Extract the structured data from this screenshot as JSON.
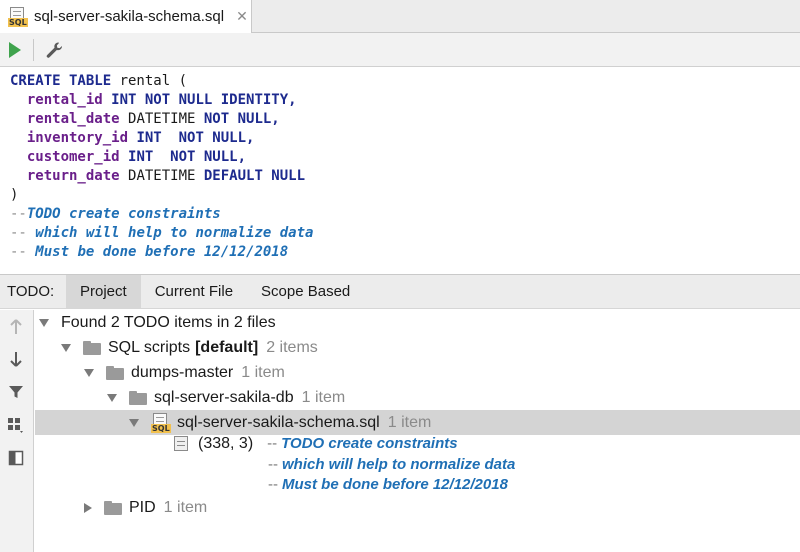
{
  "tab": {
    "title": "sql-server-sakila-schema.sql",
    "close_glyph": "✕",
    "icon_label": "SQL",
    "icon": "sql-file-icon"
  },
  "toolbar": {
    "run_icon": "run-icon",
    "settings_icon": "wrench-icon"
  },
  "editor": {
    "lines": [
      [
        {
          "t": "CREATE TABLE ",
          "c": "kw"
        },
        {
          "t": "rental (",
          "c": "pl"
        }
      ],
      [
        {
          "t": "  rental_id ",
          "c": "id"
        },
        {
          "t": "INT NOT NULL IDENTITY,",
          "c": "kw"
        }
      ],
      [
        {
          "t": "  rental_date ",
          "c": "id"
        },
        {
          "t": "DATETIME ",
          "c": "pl"
        },
        {
          "t": "NOT NULL,",
          "c": "kw"
        }
      ],
      [
        {
          "t": "  inventory_id ",
          "c": "id"
        },
        {
          "t": "INT  NOT NULL,",
          "c": "kw"
        }
      ],
      [
        {
          "t": "  customer_id ",
          "c": "id"
        },
        {
          "t": "INT  NOT NULL,",
          "c": "kw"
        }
      ],
      [
        {
          "t": "  return_date ",
          "c": "id"
        },
        {
          "t": "DATETIME ",
          "c": "pl"
        },
        {
          "t": "DEFAULT NULL",
          "c": "kw"
        }
      ],
      [
        {
          "t": ")",
          "c": "pl"
        }
      ],
      [
        {
          "t": "--",
          "c": "cm"
        },
        {
          "t": "TODO create constraints",
          "c": "todo"
        }
      ],
      [
        {
          "t": "-- ",
          "c": "cm"
        },
        {
          "t": "which will help to normalize data",
          "c": "todo"
        }
      ],
      [
        {
          "t": "-- ",
          "c": "cm"
        },
        {
          "t": "Must be done before 12/12/2018",
          "c": "todo"
        }
      ]
    ]
  },
  "todo_panel": {
    "label": "TODO:",
    "tabs": [
      {
        "label": "Project",
        "active": true
      },
      {
        "label": "Current File",
        "active": false
      },
      {
        "label": "Scope Based",
        "active": false
      }
    ],
    "strip_icons": [
      "arrow-up-icon",
      "arrow-down-icon",
      "filter-icon",
      "group-by-icon",
      "preview-panel-icon"
    ]
  },
  "tree": {
    "root": "Found 2 TODO items in 2 files",
    "sql_scripts": {
      "name": "SQL scripts",
      "tag": "[default]",
      "count": "2 items"
    },
    "dumps_master": {
      "name": "dumps-master",
      "count": "1 item"
    },
    "sakila_db": {
      "name": "sql-server-sakila-db",
      "count": "1 item"
    },
    "schema_file": {
      "name": "sql-server-sakila-schema.sql",
      "count": "1 item"
    },
    "todo_item": {
      "position": "(338, 3)",
      "dash1": "--",
      "text1": "TODO create constraints",
      "dash2": "--",
      "text2": "which will help to normalize data",
      "dash3": "--",
      "text3": "Must be done before 12/12/2018"
    },
    "pid": {
      "name": "PID",
      "count": "1 item"
    }
  }
}
